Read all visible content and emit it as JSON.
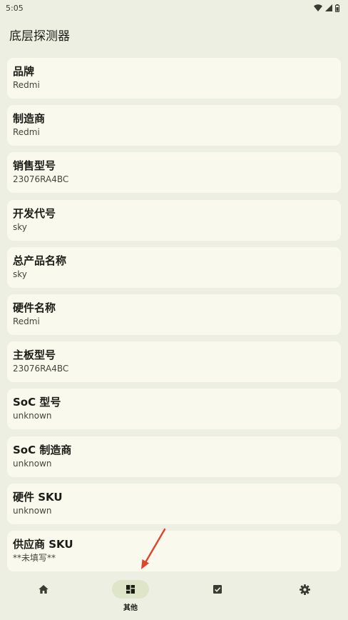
{
  "status_bar": {
    "time": "5:05",
    "icons": [
      "wifi-icon",
      "cellular-icon",
      "battery-icon"
    ]
  },
  "app": {
    "title": "底层探测器"
  },
  "cards": [
    {
      "title": "品牌",
      "value": "Redmi"
    },
    {
      "title": "制造商",
      "value": "Redmi"
    },
    {
      "title": "销售型号",
      "value": "23076RA4BC"
    },
    {
      "title": "开发代号",
      "value": "sky"
    },
    {
      "title": "总产品名称",
      "value": "sky"
    },
    {
      "title": "硬件名称",
      "value": "Redmi"
    },
    {
      "title": "主板型号",
      "value": "23076RA4BC"
    },
    {
      "title": "SoC 型号",
      "value": "unknown"
    },
    {
      "title": "SoC 制造商",
      "value": "unknown"
    },
    {
      "title": "硬件 SKU",
      "value": "unknown"
    },
    {
      "title": "供应商 SKU",
      "value": "**未填写**"
    }
  ],
  "bottom_nav": {
    "items": [
      {
        "icon": "home-icon",
        "label": ""
      },
      {
        "icon": "dashboard-icon",
        "label": "其他",
        "active": true
      },
      {
        "icon": "checkbox-icon",
        "label": ""
      },
      {
        "icon": "gear-icon",
        "label": ""
      }
    ]
  },
  "annotation": {
    "arrow_color": "#e0442b",
    "icon": "arrow-annotation"
  }
}
